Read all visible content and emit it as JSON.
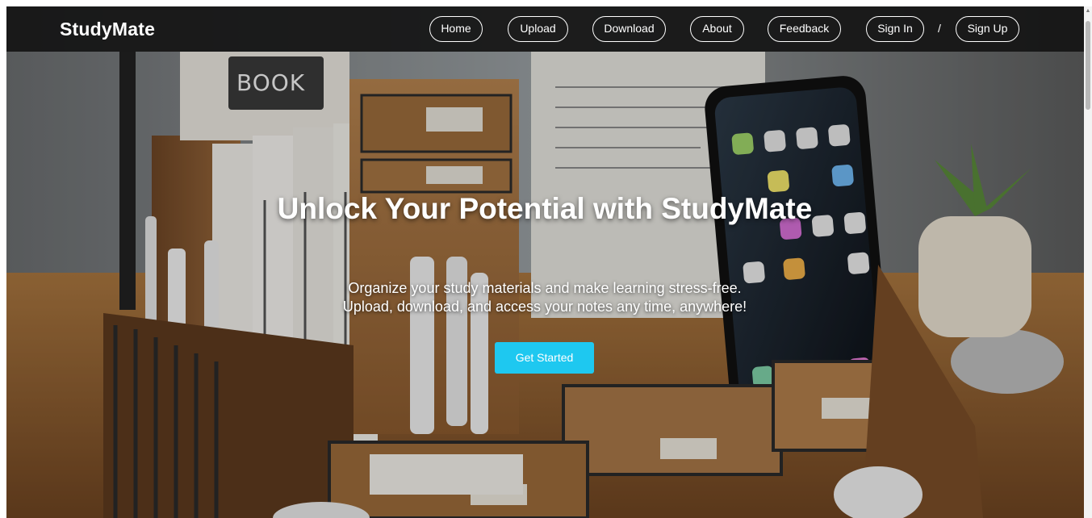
{
  "navbar": {
    "brand": "StudyMate",
    "links": [
      {
        "label": "Home"
      },
      {
        "label": "Upload"
      },
      {
        "label": "Download"
      },
      {
        "label": "About"
      },
      {
        "label": "Feedback"
      },
      {
        "label": "Sign In"
      },
      {
        "label": "Sign Up"
      }
    ],
    "separator": "/"
  },
  "hero": {
    "title": "Unlock Your Potential with StudyMate",
    "subtitle_line1": "Organize your study materials and make learning stress-free.",
    "subtitle_line2": "Upload, download, and access your notes any time, anywhere!",
    "cta_label": "Get Started",
    "background": {
      "book_sign": "BOOK"
    }
  },
  "colors": {
    "navbar_bg": "#141414",
    "cta_bg": "#1ec8f0",
    "text": "#ffffff"
  },
  "icons": {
    "scroll_up": "up-arrow-icon"
  }
}
